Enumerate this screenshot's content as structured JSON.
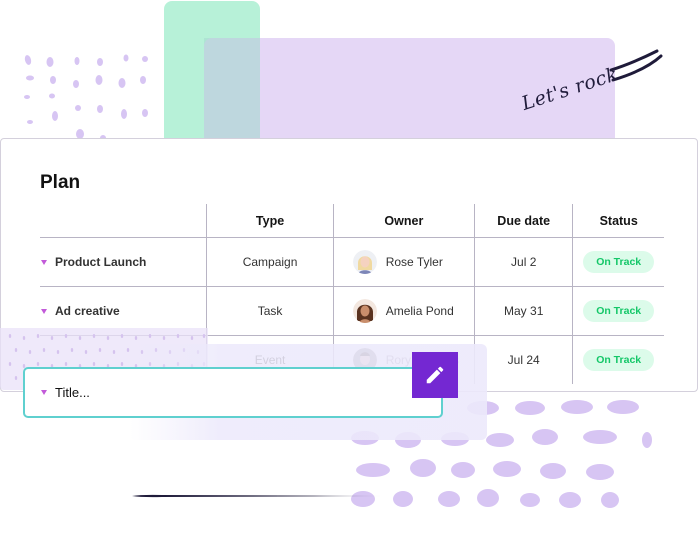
{
  "decor": {
    "tagline": "Let's rock",
    "colors": {
      "mint_block": "#b3f0d6",
      "lilac_block": "#e1d0f5",
      "dots": "#d7c5f3",
      "accent_purple": "#7428d2",
      "input_border": "#5fd0cf"
    }
  },
  "plan": {
    "title": "Plan",
    "columns": [
      "",
      "Type",
      "Owner",
      "Due date",
      "Status"
    ],
    "rows": [
      {
        "name": "Product Launch",
        "type": "Campaign",
        "owner": "Rose Tyler",
        "due": "Jul 2",
        "status": "On Track"
      },
      {
        "name": "Ad creative",
        "type": "Task",
        "owner": "Amelia Pond",
        "due": "May 31",
        "status": "On Track"
      },
      {
        "name": "",
        "type": "Event",
        "owner": "Rory Williams",
        "due": "Jul 24",
        "status": "On Track"
      }
    ],
    "status_colors": {
      "on_track_bg": "#dcfbea",
      "on_track_text": "#14c768"
    }
  },
  "new_item": {
    "placeholder": "Title..."
  },
  "icons": {
    "expand": "caret-down-icon",
    "edit": "pencil-icon"
  }
}
